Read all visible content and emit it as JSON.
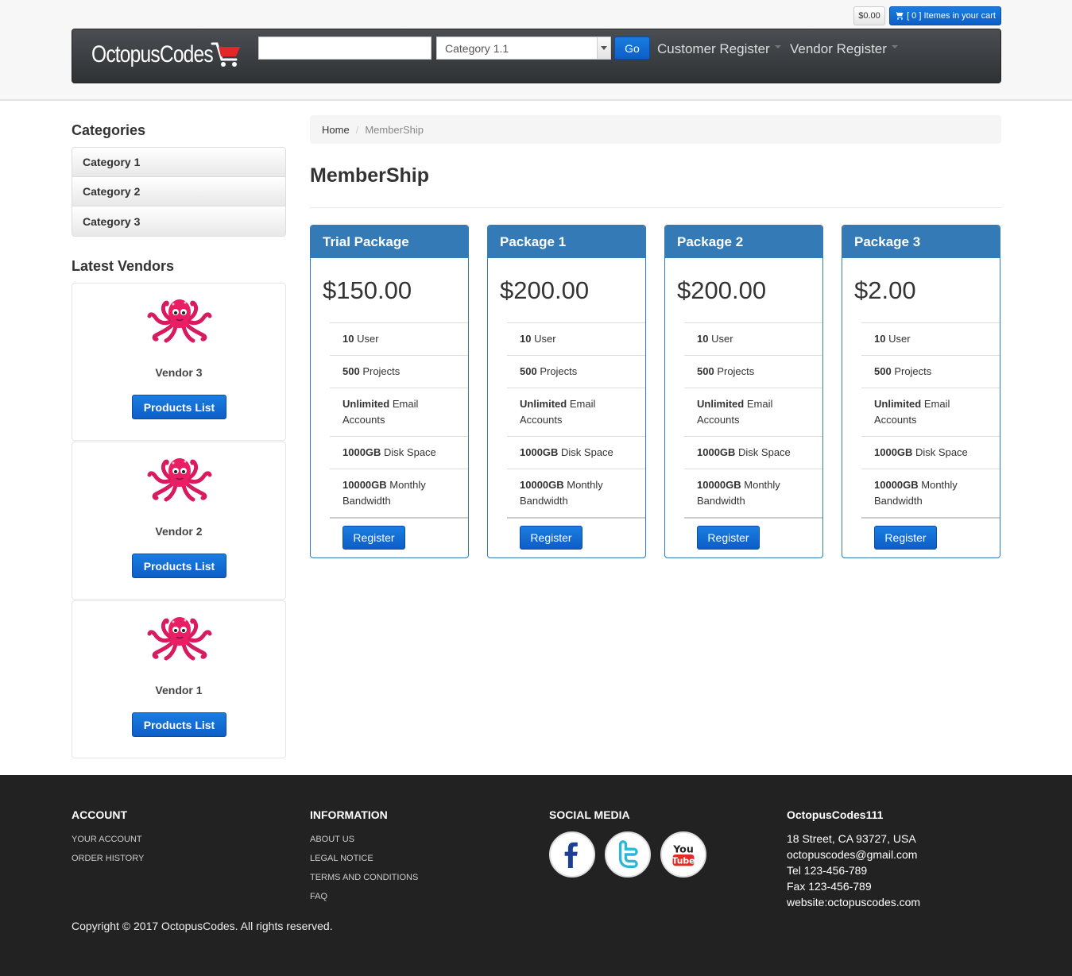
{
  "header": {
    "cart_total": "$0.00",
    "cart_label": "[ 0 ] Itemes in your cart",
    "brand": "OctopusCodes",
    "search_placeholder": "",
    "category_selected": "Category 1.1",
    "go_label": "Go",
    "nav": [
      "Customer Register",
      "Vendor Register"
    ]
  },
  "sidebar": {
    "categories_title": "Categories",
    "categories": [
      "Category 1",
      "Category 2",
      "Category 3"
    ],
    "vendors_title": "Latest Vendors",
    "vendors": [
      {
        "name": "Vendor 3",
        "button": "Products List"
      },
      {
        "name": "Vendor 2",
        "button": "Products List"
      },
      {
        "name": "Vendor 1",
        "button": "Products List"
      }
    ]
  },
  "breadcrumb": {
    "home": "Home",
    "current": "MemberShip"
  },
  "main": {
    "title": "MemberShip",
    "packages": [
      {
        "name": "Trial Package",
        "price": "$150.00",
        "button": "Register",
        "features": [
          [
            "10",
            " User"
          ],
          [
            "500",
            " Projects"
          ],
          [
            "Unlimited",
            " Email Accounts"
          ],
          [
            "1000GB",
            " Disk Space"
          ],
          [
            "10000GB",
            " Monthly Bandwidth"
          ]
        ]
      },
      {
        "name": "Package 1",
        "price": "$200.00",
        "button": "Register",
        "features": [
          [
            "10",
            " User"
          ],
          [
            "500",
            " Projects"
          ],
          [
            "Unlimited",
            " Email Accounts"
          ],
          [
            "1000GB",
            " Disk Space"
          ],
          [
            "10000GB",
            " Monthly Bandwidth"
          ]
        ]
      },
      {
        "name": "Package 2",
        "price": "$200.00",
        "button": "Register",
        "features": [
          [
            "10",
            " User"
          ],
          [
            "500",
            " Projects"
          ],
          [
            "Unlimited",
            " Email Accounts"
          ],
          [
            "1000GB",
            " Disk Space"
          ],
          [
            "10000GB",
            " Monthly Bandwidth"
          ]
        ]
      },
      {
        "name": "Package 3",
        "price": "$2.00",
        "button": "Register",
        "features": [
          [
            "10",
            " User"
          ],
          [
            "500",
            " Projects"
          ],
          [
            "Unlimited",
            " Email Accounts"
          ],
          [
            "1000GB",
            " Disk Space"
          ],
          [
            "10000GB",
            " Monthly Bandwidth"
          ]
        ]
      }
    ]
  },
  "footer": {
    "account_title": "ACCOUNT",
    "account_links": [
      "YOUR ACCOUNT",
      "ORDER HISTORY"
    ],
    "info_title": "INFORMATION",
    "info_links": [
      "ABOUT US",
      "LEGAL NOTICE",
      "TERMS AND CONDITIONS",
      "FAQ"
    ],
    "social_title": "SOCIAL MEDIA",
    "social": [
      "facebook-icon",
      "twitter-icon",
      "youtube-icon"
    ],
    "company_title": "OctopusCodes111",
    "contact": [
      "18 Street, CA 93727, USA",
      "octopuscodes@gmail.com",
      "Tel 123-456-789",
      "Fax 123-456-789",
      "website:octopuscodes.com"
    ],
    "copyright": "Copyright © 2017 OctopusCodes. All rights reserved."
  },
  "colors": {
    "primary": "#337ab7",
    "button": "#0d5ec7",
    "navbar": "#3a3d40",
    "footer": "#222222"
  }
}
